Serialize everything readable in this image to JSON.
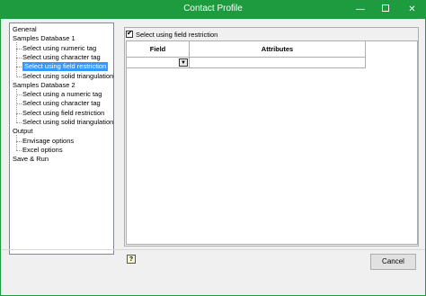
{
  "window": {
    "title": "Contact Profile",
    "min_glyph": "—",
    "close_glyph": "✕"
  },
  "tree": {
    "items": [
      {
        "label": "General",
        "level": 0
      },
      {
        "label": "Samples Database 1",
        "level": 0
      },
      {
        "label": "Select using numeric tag",
        "level": 1
      },
      {
        "label": "Select using character tag",
        "level": 1
      },
      {
        "label": "Select using field restriction",
        "level": 1,
        "selected": true
      },
      {
        "label": "Select using solid triangulation",
        "level": 1
      },
      {
        "label": "Samples Database 2",
        "level": 0
      },
      {
        "label": "Select using a numeric tag",
        "level": 1
      },
      {
        "label": "Select using character tag",
        "level": 1
      },
      {
        "label": "Select using field restriction",
        "level": 1
      },
      {
        "label": "Select using solid triangulation",
        "level": 1
      },
      {
        "label": "Output",
        "level": 0
      },
      {
        "label": "Envisage options",
        "level": 1
      },
      {
        "label": "Excel options",
        "level": 1
      },
      {
        "label": "Save & Run",
        "level": 0
      }
    ]
  },
  "panel": {
    "checkbox_label": "Select using field restriction",
    "checkbox_checked": true,
    "check_glyph": "✔",
    "columns": [
      "Field",
      "Attributes"
    ],
    "dropdown_glyph": "▼"
  },
  "help_glyph": "?",
  "footer": {
    "cancel_label": "Cancel"
  }
}
